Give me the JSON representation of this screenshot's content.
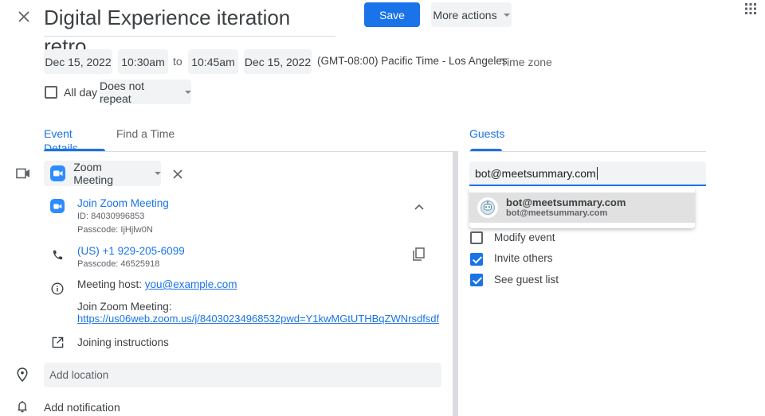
{
  "header": {
    "title": "Digital Experience iteration retro",
    "save_label": "Save",
    "more_actions_label": "More actions"
  },
  "datetime": {
    "start_date": "Dec 15, 2022",
    "start_time": "10:30am",
    "to_label": "to",
    "end_time": "10:45am",
    "end_date": "Dec 15, 2022",
    "timezone": "(GMT-08:00) Pacific Time - Los Angeles",
    "timezone_button": "Time zone",
    "all_day_label": "All day",
    "all_day_checked": false,
    "repeat": "Does not repeat"
  },
  "tabs": {
    "event_details": "Event Details",
    "find_a_time": "Find a Time",
    "active": "event_details"
  },
  "conference": {
    "provider": "Zoom Meeting",
    "join_label": "Join Zoom Meeting",
    "meeting_id": "ID: 84030996853",
    "passcode": "Passcode: IjHjlw0N",
    "phone": "(US) +1 929-205-6099",
    "phone_passcode": "Passcode: 46525918",
    "host_label": "Meeting host: ",
    "host_email": "you@example.com",
    "join_text": "Join Zoom Meeting:",
    "join_url": "https://us06web.zoom.us/j/84030234968532pwd=Y1kwMGtUTHBqZWNrsdfsdf",
    "instructions_label": "Joining instructions"
  },
  "location": {
    "placeholder": "Add location"
  },
  "notification": {
    "label": "Add notification"
  },
  "guests": {
    "tab_label": "Guests",
    "input_value": "bot@meetsummary.com",
    "suggestion": {
      "name": "bot@meetsummary.com",
      "email": "bot@meetsummary.com"
    },
    "permissions": [
      {
        "label": "Modify event",
        "checked": false
      },
      {
        "label": "Invite others",
        "checked": true
      },
      {
        "label": "See guest list",
        "checked": true
      }
    ]
  },
  "colors": {
    "accent": "#1a73e8",
    "zoom_blue": "#2d8cff",
    "chip_bg": "#f1f3f4"
  }
}
